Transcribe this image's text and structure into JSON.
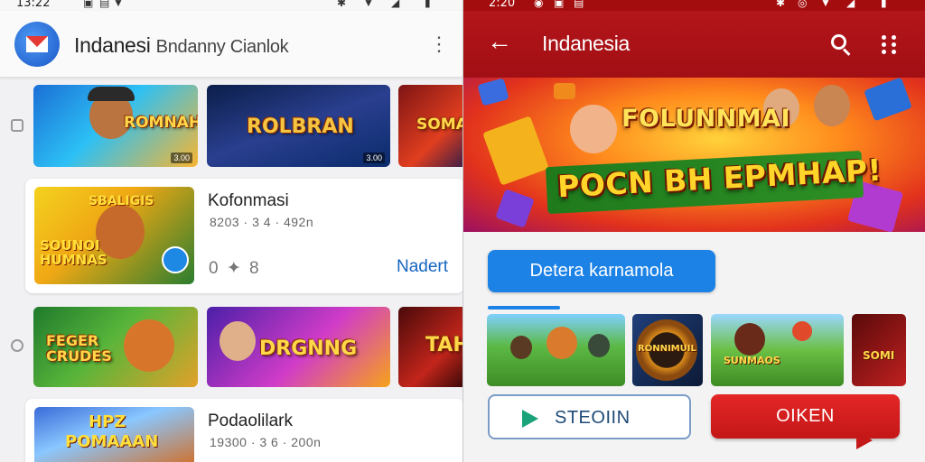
{
  "left": {
    "status": {
      "time": "13:22"
    },
    "appbar": {
      "title": "Indanesi",
      "subtitle": "Bndanny Cianlok",
      "logo_icon": "mail-app-icon",
      "menu_icon": "more-vert-icon"
    },
    "row1": [
      {
        "title": "ROMNAH",
        "meta": "3.00"
      },
      {
        "title": "ROLBRAN",
        "meta": "3.00"
      },
      {
        "title": "SOMA",
        "meta": ""
      }
    ],
    "card1": {
      "thumb_title": "SOUNOI HUMNAS",
      "thumb_top": "SBALIGIS",
      "name": "Kofonmasi",
      "info": "8203 · 3  4 · 492n",
      "rating": "0 ✦ 8",
      "action": "Nadert"
    },
    "row2": [
      {
        "title": "FEGER CRUDES"
      },
      {
        "title": "DRGNNG"
      },
      {
        "title": "TAH"
      }
    ],
    "card2": {
      "thumb_title": "POMAAAN",
      "thumb_top": "HPZ",
      "name": "Podaolilark",
      "info": "19300 · 3  6 · 200n"
    }
  },
  "right": {
    "status": {
      "time": "2:20"
    },
    "appbar": {
      "title": "Indanesia",
      "back_icon": "arrow-back-icon",
      "search_icon": "search-icon",
      "menu_icon": "more-vert-icon"
    },
    "banner": {
      "title": "FOLUNNMAI",
      "subtitle": "POCN BH EPMHAP!"
    },
    "primary_button": "Detera karnamola",
    "thumbs": [
      {
        "title": ""
      },
      {
        "title": "RONNIMUIL"
      },
      {
        "title": "SUNMAOS"
      },
      {
        "title": "SOMI"
      }
    ],
    "secondary_button": "STEOIIN",
    "red_button": "OIKEN"
  },
  "colors": {
    "left_accent": "#1565c0",
    "right_brand": "#b3151a",
    "primary_blue": "#1c82e6",
    "cta_red": "#e42626",
    "play_green": "#1aa37a"
  }
}
